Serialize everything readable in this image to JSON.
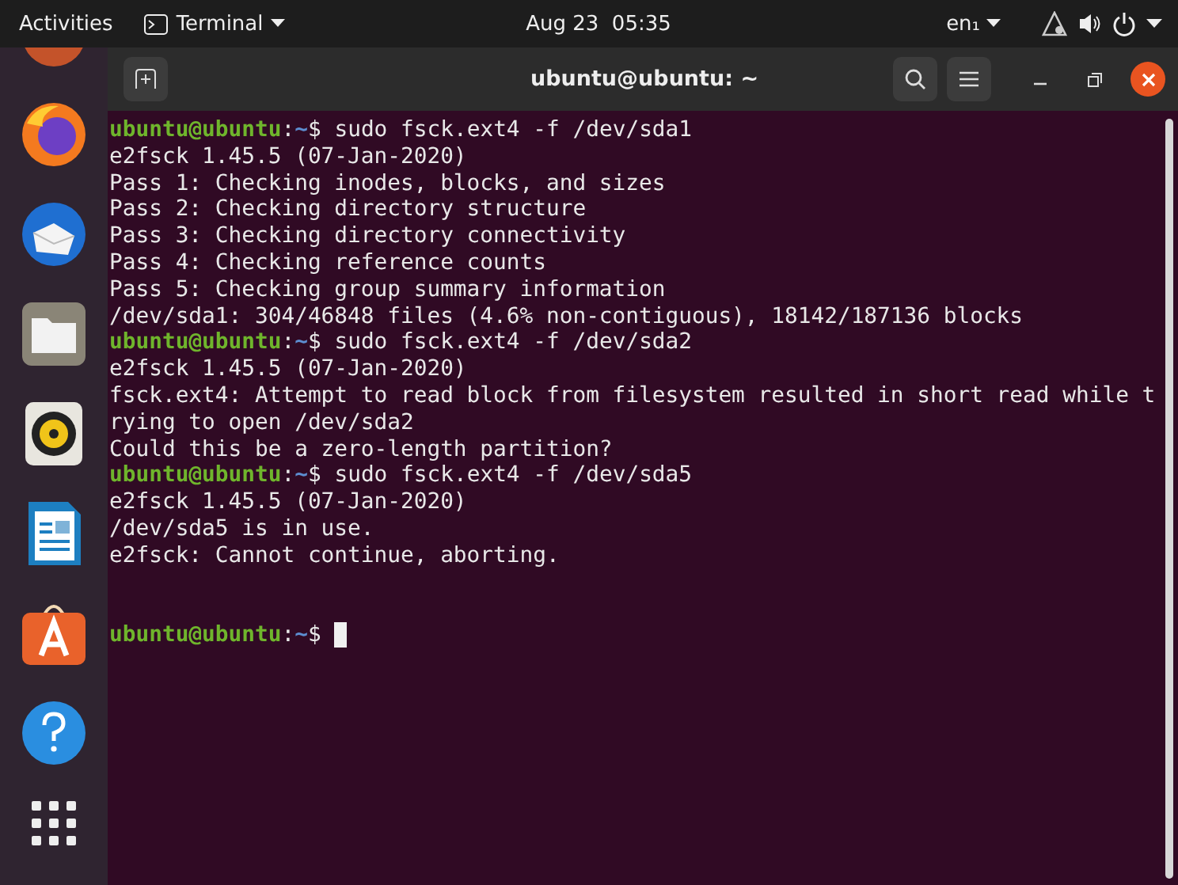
{
  "top_bar": {
    "activities": "Activities",
    "app_menu": "Terminal",
    "clock": "Aug 23  05:35",
    "keyboard_layout": "en₁"
  },
  "window": {
    "title": "ubuntu@ubuntu: ~"
  },
  "dock": [
    {
      "kind": "partial"
    },
    {
      "kind": "firefox"
    },
    {
      "kind": "mail"
    },
    {
      "kind": "files"
    },
    {
      "kind": "music"
    },
    {
      "kind": "writer"
    },
    {
      "kind": "store"
    },
    {
      "kind": "help"
    },
    {
      "kind": "apps"
    }
  ],
  "terminal": {
    "lines": [
      {
        "kind": "prompt",
        "user": "ubuntu@ubuntu",
        "separator": ":",
        "path": "~",
        "symbol": "$",
        "command": "sudo fsck.ext4 -f /dev/sda1"
      },
      {
        "kind": "output",
        "text": "e2fsck 1.45.5 (07-Jan-2020)"
      },
      {
        "kind": "output",
        "text": "Pass 1: Checking inodes, blocks, and sizes"
      },
      {
        "kind": "output",
        "text": "Pass 2: Checking directory structure"
      },
      {
        "kind": "output",
        "text": "Pass 3: Checking directory connectivity"
      },
      {
        "kind": "output",
        "text": "Pass 4: Checking reference counts"
      },
      {
        "kind": "output",
        "text": "Pass 5: Checking group summary information"
      },
      {
        "kind": "output",
        "text": "/dev/sda1: 304/46848 files (4.6% non-contiguous), 18142/187136 blocks"
      },
      {
        "kind": "prompt",
        "user": "ubuntu@ubuntu",
        "separator": ":",
        "path": "~",
        "symbol": "$",
        "command": "sudo fsck.ext4 -f /dev/sda2"
      },
      {
        "kind": "output",
        "text": "e2fsck 1.45.5 (07-Jan-2020)"
      },
      {
        "kind": "output",
        "text": "fsck.ext4: Attempt to read block from filesystem resulted in short read while t"
      },
      {
        "kind": "output",
        "text": "rying to open /dev/sda2"
      },
      {
        "kind": "output",
        "text": "Could this be a zero-length partition?"
      },
      {
        "kind": "prompt",
        "user": "ubuntu@ubuntu",
        "separator": ":",
        "path": "~",
        "symbol": "$",
        "command": "sudo fsck.ext4 -f /dev/sda5"
      },
      {
        "kind": "output",
        "text": "e2fsck 1.45.5 (07-Jan-2020)"
      },
      {
        "kind": "output",
        "text": "/dev/sda5 is in use."
      },
      {
        "kind": "output",
        "text": "e2fsck: Cannot continue, aborting."
      },
      {
        "kind": "prompt",
        "user": "ubuntu@ubuntu",
        "separator": ":",
        "path": "~",
        "symbol": "$",
        "cursor": true
      }
    ]
  }
}
